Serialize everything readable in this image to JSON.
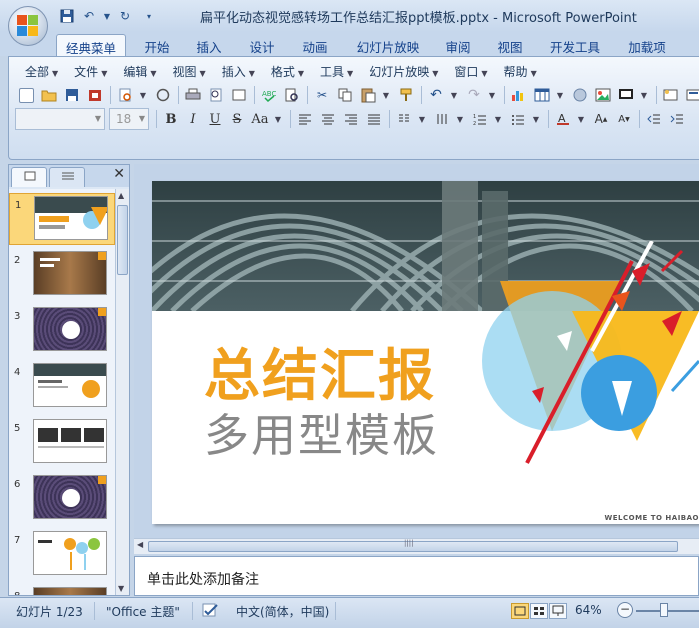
{
  "window": {
    "title": "扁平化动态视觉感转场工作总结汇报ppt模板.pptx - Microsoft PowerPoint"
  },
  "ribbon_tabs": [
    "经典菜单",
    "开始",
    "插入",
    "设计",
    "动画",
    "幻灯片放映",
    "审阅",
    "视图",
    "开发工具",
    "加载项"
  ],
  "active_tab_index": 0,
  "menus": [
    "全部",
    "文件",
    "编辑",
    "视图",
    "插入",
    "格式",
    "工具",
    "幻灯片放映",
    "窗口",
    "帮助"
  ],
  "font_combo": {
    "font_name": "",
    "font_size": "18"
  },
  "format_buttons": [
    "B",
    "I",
    "U",
    "S",
    "Aa"
  ],
  "thumbnails": [
    {
      "num": "1",
      "selected": true
    },
    {
      "num": "2",
      "selected": false
    },
    {
      "num": "3",
      "selected": false
    },
    {
      "num": "4",
      "selected": false
    },
    {
      "num": "5",
      "selected": false
    },
    {
      "num": "6",
      "selected": false
    },
    {
      "num": "7",
      "selected": false
    },
    {
      "num": "8",
      "selected": false
    }
  ],
  "slide": {
    "title": "总结汇报",
    "subtitle": "多用型模板",
    "welcome": "WELCOME TO HAIBAO",
    "title_color": "#f0a01e"
  },
  "notes": {
    "placeholder": "单击此处添加备注"
  },
  "status": {
    "slide_info": "幻灯片 1/23",
    "theme": "\"Office 主题\"",
    "language": "中文(简体，中国)",
    "zoom": "64%"
  }
}
